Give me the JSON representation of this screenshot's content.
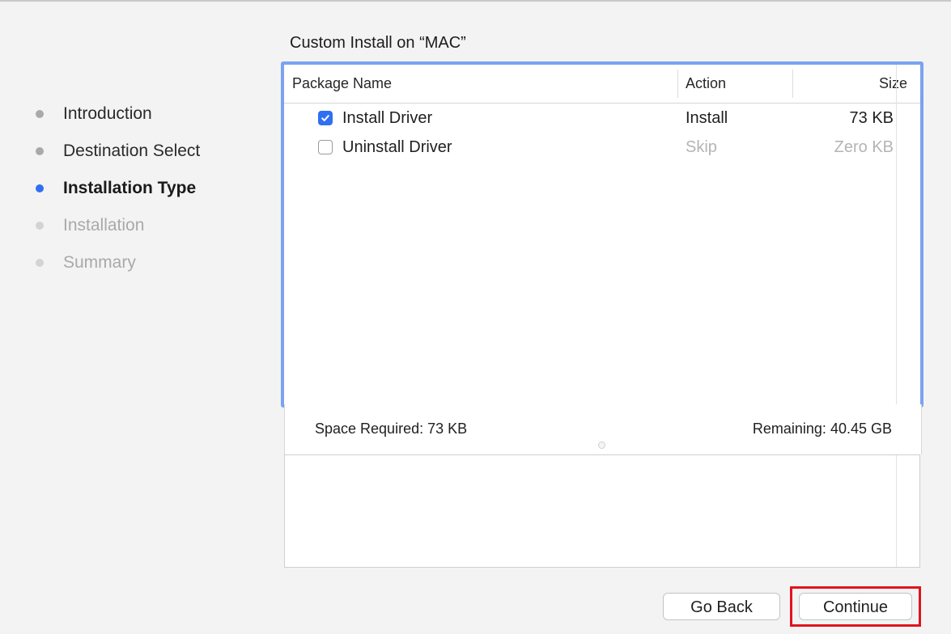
{
  "pane_title": "Custom Install on “MAC”",
  "steps": [
    {
      "label": "Introduction",
      "state": "done"
    },
    {
      "label": "Destination Select",
      "state": "done"
    },
    {
      "label": "Installation Type",
      "state": "current"
    },
    {
      "label": "Installation",
      "state": "pending"
    },
    {
      "label": "Summary",
      "state": "pending"
    }
  ],
  "table": {
    "headers": {
      "name": "Package Name",
      "action": "Action",
      "size": "Size"
    },
    "rows": [
      {
        "name": "Install Driver",
        "checked": true,
        "action": "Install",
        "size": "73 KB"
      },
      {
        "name": "Uninstall Driver",
        "checked": false,
        "action": "Skip",
        "size": "Zero KB"
      }
    ]
  },
  "space": {
    "required": "Space Required:  73 KB",
    "remaining": "Remaining:  40.45 GB"
  },
  "buttons": {
    "back": "Go Back",
    "continue": "Continue"
  },
  "colors": {
    "accent": "#2f6ff2",
    "focus_ring": "#7aa3f0",
    "highlight": "#e0141e"
  },
  "icons": {
    "checkbox_checked": "checkmark-icon",
    "split_handle": "split-handle-icon"
  }
}
